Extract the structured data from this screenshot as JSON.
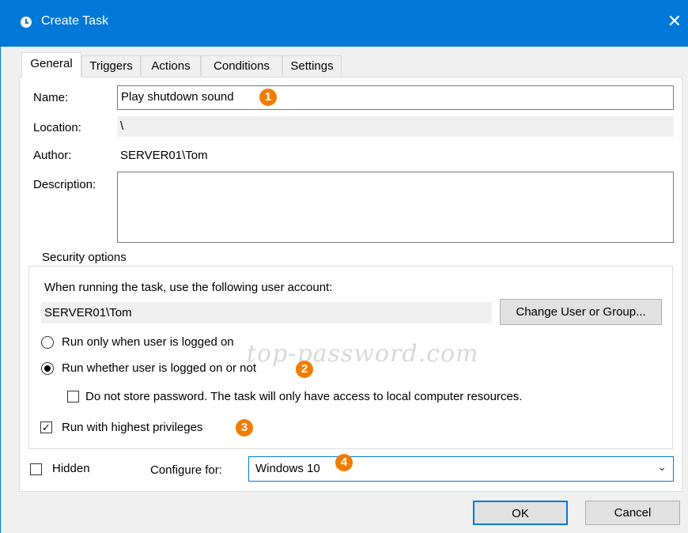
{
  "window": {
    "title": "Create Task",
    "close_glyph": "✕"
  },
  "tabs": [
    {
      "label": "General"
    },
    {
      "label": "Triggers"
    },
    {
      "label": "Actions"
    },
    {
      "label": "Conditions"
    },
    {
      "label": "Settings"
    }
  ],
  "general": {
    "name_label": "Name:",
    "name_value": "Play shutdown sound",
    "location_label": "Location:",
    "location_value": "\\",
    "author_label": "Author:",
    "author_value": "SERVER01\\Tom",
    "description_label": "Description:",
    "description_value": ""
  },
  "security": {
    "legend": "Security options",
    "account_prompt": "When running the task, use the following user account:",
    "account_value": "SERVER01\\Tom",
    "change_button": "Change User or Group...",
    "radio_logged_on": "Run only when user is logged on",
    "radio_whether": "Run whether user is logged on or not",
    "no_store_password": "Do not store password.  The task will only have access to local computer resources.",
    "highest_privileges": "Run with highest privileges",
    "selected_radio": "whether",
    "highest_privileges_checked": true,
    "no_store_password_checked": false
  },
  "bottom": {
    "hidden_label": "Hidden",
    "hidden_checked": false,
    "configure_label": "Configure for:",
    "configure_value": "Windows 10"
  },
  "buttons": {
    "ok": "OK",
    "cancel": "Cancel"
  },
  "badges": [
    "1",
    "2",
    "3",
    "4"
  ],
  "watermark": "top-password.com",
  "colors": {
    "titlebar": "#0078d7",
    "badge": "#f07d00",
    "dialog_bg": "#f0f0f0"
  },
  "icons": {
    "title": "clock-icon",
    "combo": "chevron-down-icon",
    "close": "close-icon"
  }
}
